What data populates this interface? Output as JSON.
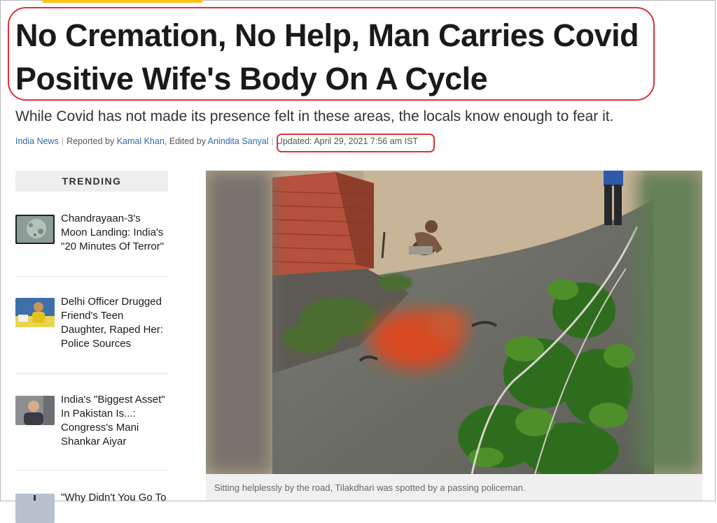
{
  "article": {
    "headline": "No Cremation, No Help, Man Carries Covid Positive Wife's Body On A Cycle",
    "subheadline": "While Covid has not made its presence felt in these areas, the locals know enough to fear it.",
    "byline": {
      "category": "India News",
      "reported_prefix": "Reported by",
      "reporter": "Kamal Khan",
      "edited_prefix": ", Edited by",
      "editor": "Anindita Sanyal",
      "updated": "Updated: April 29, 2021 7:56 am IST"
    },
    "media": {
      "caption": "Sitting helplessly by the road, Tilakdhari was spotted by a passing policeman."
    }
  },
  "sidebar": {
    "trending_label": "TRENDING",
    "items": [
      {
        "title": "Chandrayaan-3's Moon Landing: India's \"20 Minutes Of Terror\""
      },
      {
        "title": "Delhi Officer Drugged Friend's Teen Daughter, Raped Her: Police Sources"
      },
      {
        "title": "India's \"Biggest Asset\" In Pakistan Is...: Congress's Mani Shankar Aiyar"
      },
      {
        "title": "\"Why Didn't You Go To"
      }
    ]
  },
  "colors": {
    "link": "#2f6aa8",
    "annotation_red": "#e0303a",
    "headline": "#1a1a1a"
  }
}
